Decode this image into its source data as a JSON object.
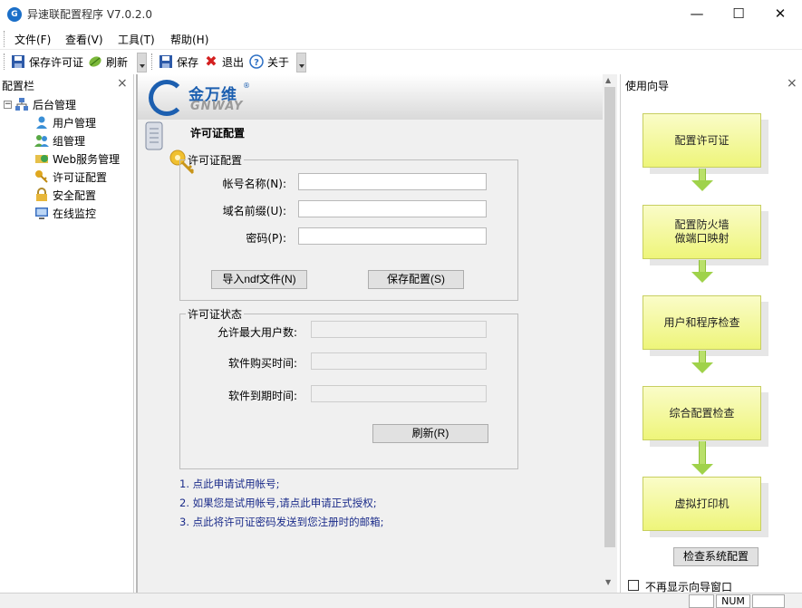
{
  "window": {
    "title": "异速联配置程序 V7.0.2.0",
    "app_icon": "gnway-logo-icon",
    "minimize": "—",
    "maximize": "☐",
    "close": "✕"
  },
  "menu": {
    "items": [
      {
        "label": "文件(F)"
      },
      {
        "label": "查看(V)"
      },
      {
        "label": "工具(T)"
      },
      {
        "label": "帮助(H)"
      }
    ]
  },
  "toolbar": {
    "save_license": "保存许可证",
    "refresh": "刷新",
    "save": "保存",
    "exit": "退出",
    "about": "关于"
  },
  "left_panel": {
    "title": "配置栏",
    "close": "×",
    "root": "后台管理",
    "items": [
      {
        "label": "用户管理",
        "icon": "user-icon"
      },
      {
        "label": "组管理",
        "icon": "group-icon"
      },
      {
        "label": "Web服务管理",
        "icon": "web-service-icon"
      },
      {
        "label": "许可证配置",
        "icon": "key-icon"
      },
      {
        "label": "安全配置",
        "icon": "lock-icon"
      },
      {
        "label": "在线监控",
        "icon": "monitor-icon"
      }
    ]
  },
  "center": {
    "logo_cn": "金万维",
    "logo_reg": "®",
    "logo_en": "GNWAY",
    "page_title": "许可证配置",
    "license_config": {
      "legend": "许可证配置",
      "account_label": "帐号名称(N):",
      "account_value": "",
      "domain_label": "域名前缀(U):",
      "domain_value": "",
      "password_label": "密码(P):",
      "password_value": "",
      "import_button": "导入ndf文件(N)",
      "save_button": "保存配置(S)"
    },
    "license_status": {
      "legend": "许可证状态",
      "max_users_label": "允许最大用户数:",
      "purchase_time_label": "软件购买时间:",
      "expire_time_label": "软件到期时间:",
      "refresh_button": "刷新(R)"
    },
    "notes": [
      "1. 点此申请试用帐号;",
      "2. 如果您是试用帐号,请点此申请正式授权;",
      "3. 点此将许可证密码发送到您注册时的邮箱;"
    ]
  },
  "right_panel": {
    "title": "使用向导",
    "close": "×",
    "steps": [
      "配置许可证",
      "配置防火墙\n做端口映射",
      "用户和程序检查",
      "综合配置检查",
      "虚拟打印机"
    ],
    "check_button": "检查系统配置",
    "dont_show_label": "不再显示向导窗口"
  },
  "statusbar": {
    "num": "NUM"
  },
  "colors": {
    "brand_blue": "#1c5fb0",
    "step_fill": "#f2f7a0",
    "arrow_green": "#9fd24a",
    "note_text": "#1b2c8a"
  }
}
